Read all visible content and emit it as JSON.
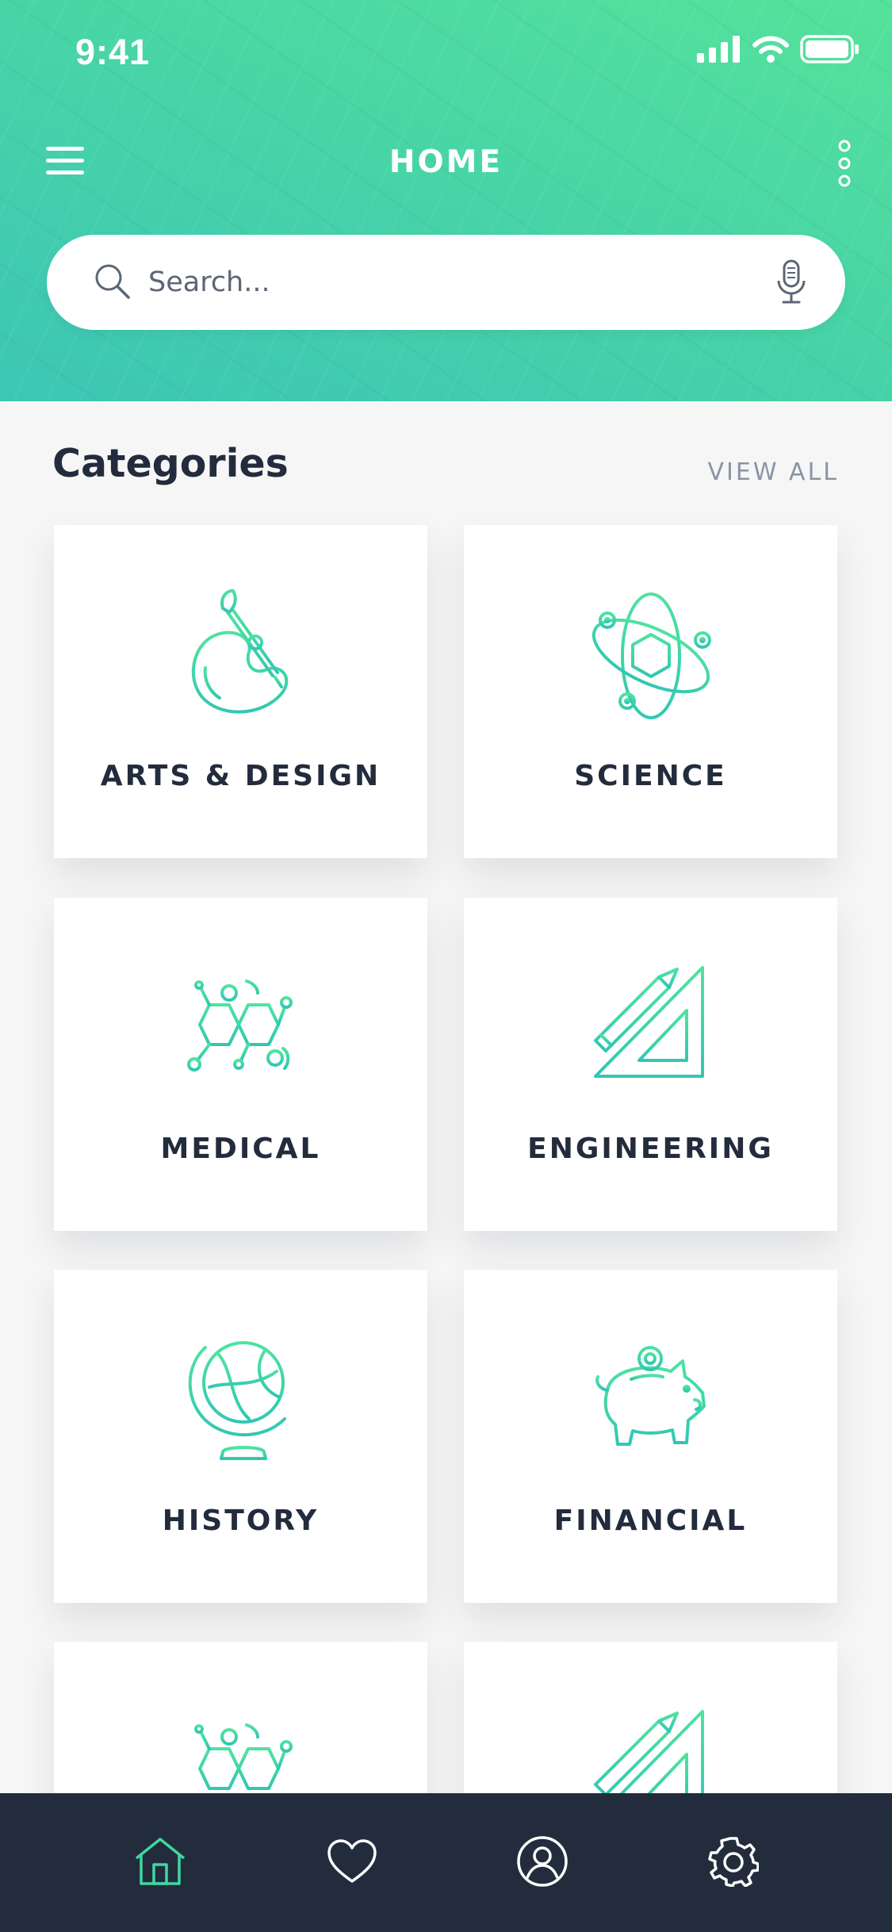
{
  "status_bar": {
    "time": "9:41"
  },
  "header": {
    "title": "HOME",
    "menu_icon": "hamburger-menu-icon",
    "more_icon": "more-vertical-icon"
  },
  "search": {
    "placeholder": "Search...",
    "value": "",
    "search_icon": "search-icon",
    "mic_icon": "microphone-icon"
  },
  "categories_section": {
    "title": "Categories",
    "view_all_label": "VIEW ALL",
    "items": [
      {
        "label": "ARTS & DESIGN",
        "icon": "paint-palette-icon"
      },
      {
        "label": "SCIENCE",
        "icon": "atom-icon"
      },
      {
        "label": "MEDICAL",
        "icon": "molecule-icon"
      },
      {
        "label": "ENGINEERING",
        "icon": "ruler-pencil-icon"
      },
      {
        "label": "HISTORY",
        "icon": "globe-icon"
      },
      {
        "label": "FINANCIAL",
        "icon": "piggy-bank-icon"
      },
      {
        "label": "",
        "icon": "molecule-icon"
      },
      {
        "label": "",
        "icon": "ruler-pencil-icon"
      }
    ]
  },
  "tab_bar": {
    "tabs": [
      {
        "icon": "home-icon",
        "active": true
      },
      {
        "icon": "heart-icon",
        "active": false
      },
      {
        "icon": "profile-icon",
        "active": false
      },
      {
        "icon": "settings-gear-icon",
        "active": false
      }
    ]
  },
  "colors": {
    "accent": "#3ed8a0",
    "header_gradient_start": "#55e29b",
    "header_gradient_end": "#3cc6b6",
    "tabbar_background": "#222c3d",
    "text_dark": "#232c3d",
    "text_muted": "#8b94a3"
  }
}
